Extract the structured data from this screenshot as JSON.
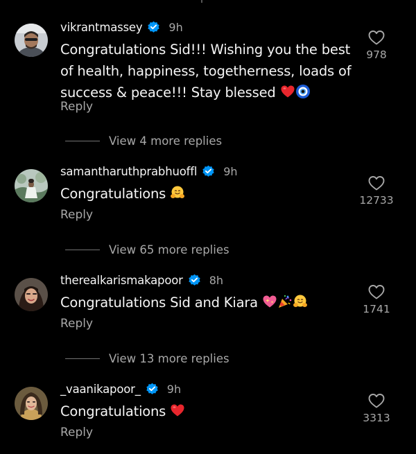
{
  "colors": {
    "background": "#000000",
    "primary_text": "#f5f5f5",
    "secondary_text": "#a8a8a8",
    "verified_blue": "#0095f6",
    "heart_red": "#ff3040"
  },
  "comments": [
    {
      "username": "vikrantmassey",
      "verified": true,
      "time": "9h",
      "text_lines": [
        "Congratulations Sid!!! Wishing you the best",
        "of health, happiness, togetherness, loads of",
        "success & peace!!! Stay blessed"
      ],
      "emojis": [
        "red-heart-emoji",
        "nazar-amulet-emoji"
      ],
      "reply_label": "Reply",
      "likes": "978",
      "view_replies": "View 4 more replies"
    },
    {
      "username": "samantharuthprabhuoffl",
      "verified": true,
      "time": "9h",
      "text_lines": [
        "Congratulations"
      ],
      "emojis": [
        "hugging-face-emoji"
      ],
      "reply_label": "Reply",
      "likes": "12733",
      "view_replies": "View 65 more replies"
    },
    {
      "username": "therealkarismakapoor",
      "verified": true,
      "time": "8h",
      "text_lines": [
        "Congratulations Sid and Kiara"
      ],
      "emojis": [
        "sparkling-heart-emoji",
        "party-popper-emoji",
        "hugging-face-emoji"
      ],
      "reply_label": "Reply",
      "likes": "1741",
      "view_replies": "View 13 more replies"
    },
    {
      "username": "_vaanikapoor_",
      "verified": true,
      "time": "9h",
      "text_lines": [
        "Congratulations"
      ],
      "emojis": [
        "red-heart-emoji"
      ],
      "reply_label": "Reply",
      "likes": "3313"
    }
  ]
}
